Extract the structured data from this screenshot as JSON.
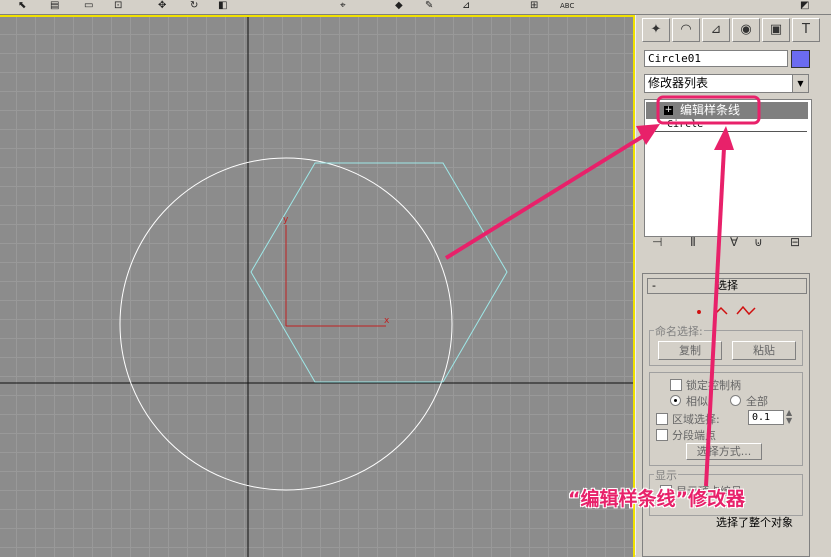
{
  "toolbar": {
    "text_tool_label": "ABC"
  },
  "panel": {
    "tabs": [
      "create-icon",
      "modify-icon",
      "hierarchy-icon",
      "motion-icon",
      "display-icon",
      "utilities-icon"
    ],
    "object_name": "Circle01",
    "object_color": "#6b6bf0",
    "modifier_list": "修改器列表",
    "stack": {
      "selected": "编辑样条线",
      "base": "Circle"
    },
    "selection": {
      "title": "选择",
      "named_selection_label": "命名选择:",
      "copy_button": "复制",
      "paste_button": "粘贴",
      "lock_handles": "锁定控制柄",
      "similar": "相似",
      "all": "全部",
      "area_select": "区域选择:",
      "area_value": "0.1",
      "segment_end": "分段端点",
      "select_by_button": "选择方式...",
      "display_label": "显示",
      "show_vertex_numbers": "显示顶点编号"
    },
    "status": "选择了整个对象"
  },
  "annotation": {
    "caption": "“编辑样条线”修改器",
    "color": "#e8216a"
  },
  "viewport": {
    "axis_x_label": "x",
    "axis_y_label": "y"
  }
}
